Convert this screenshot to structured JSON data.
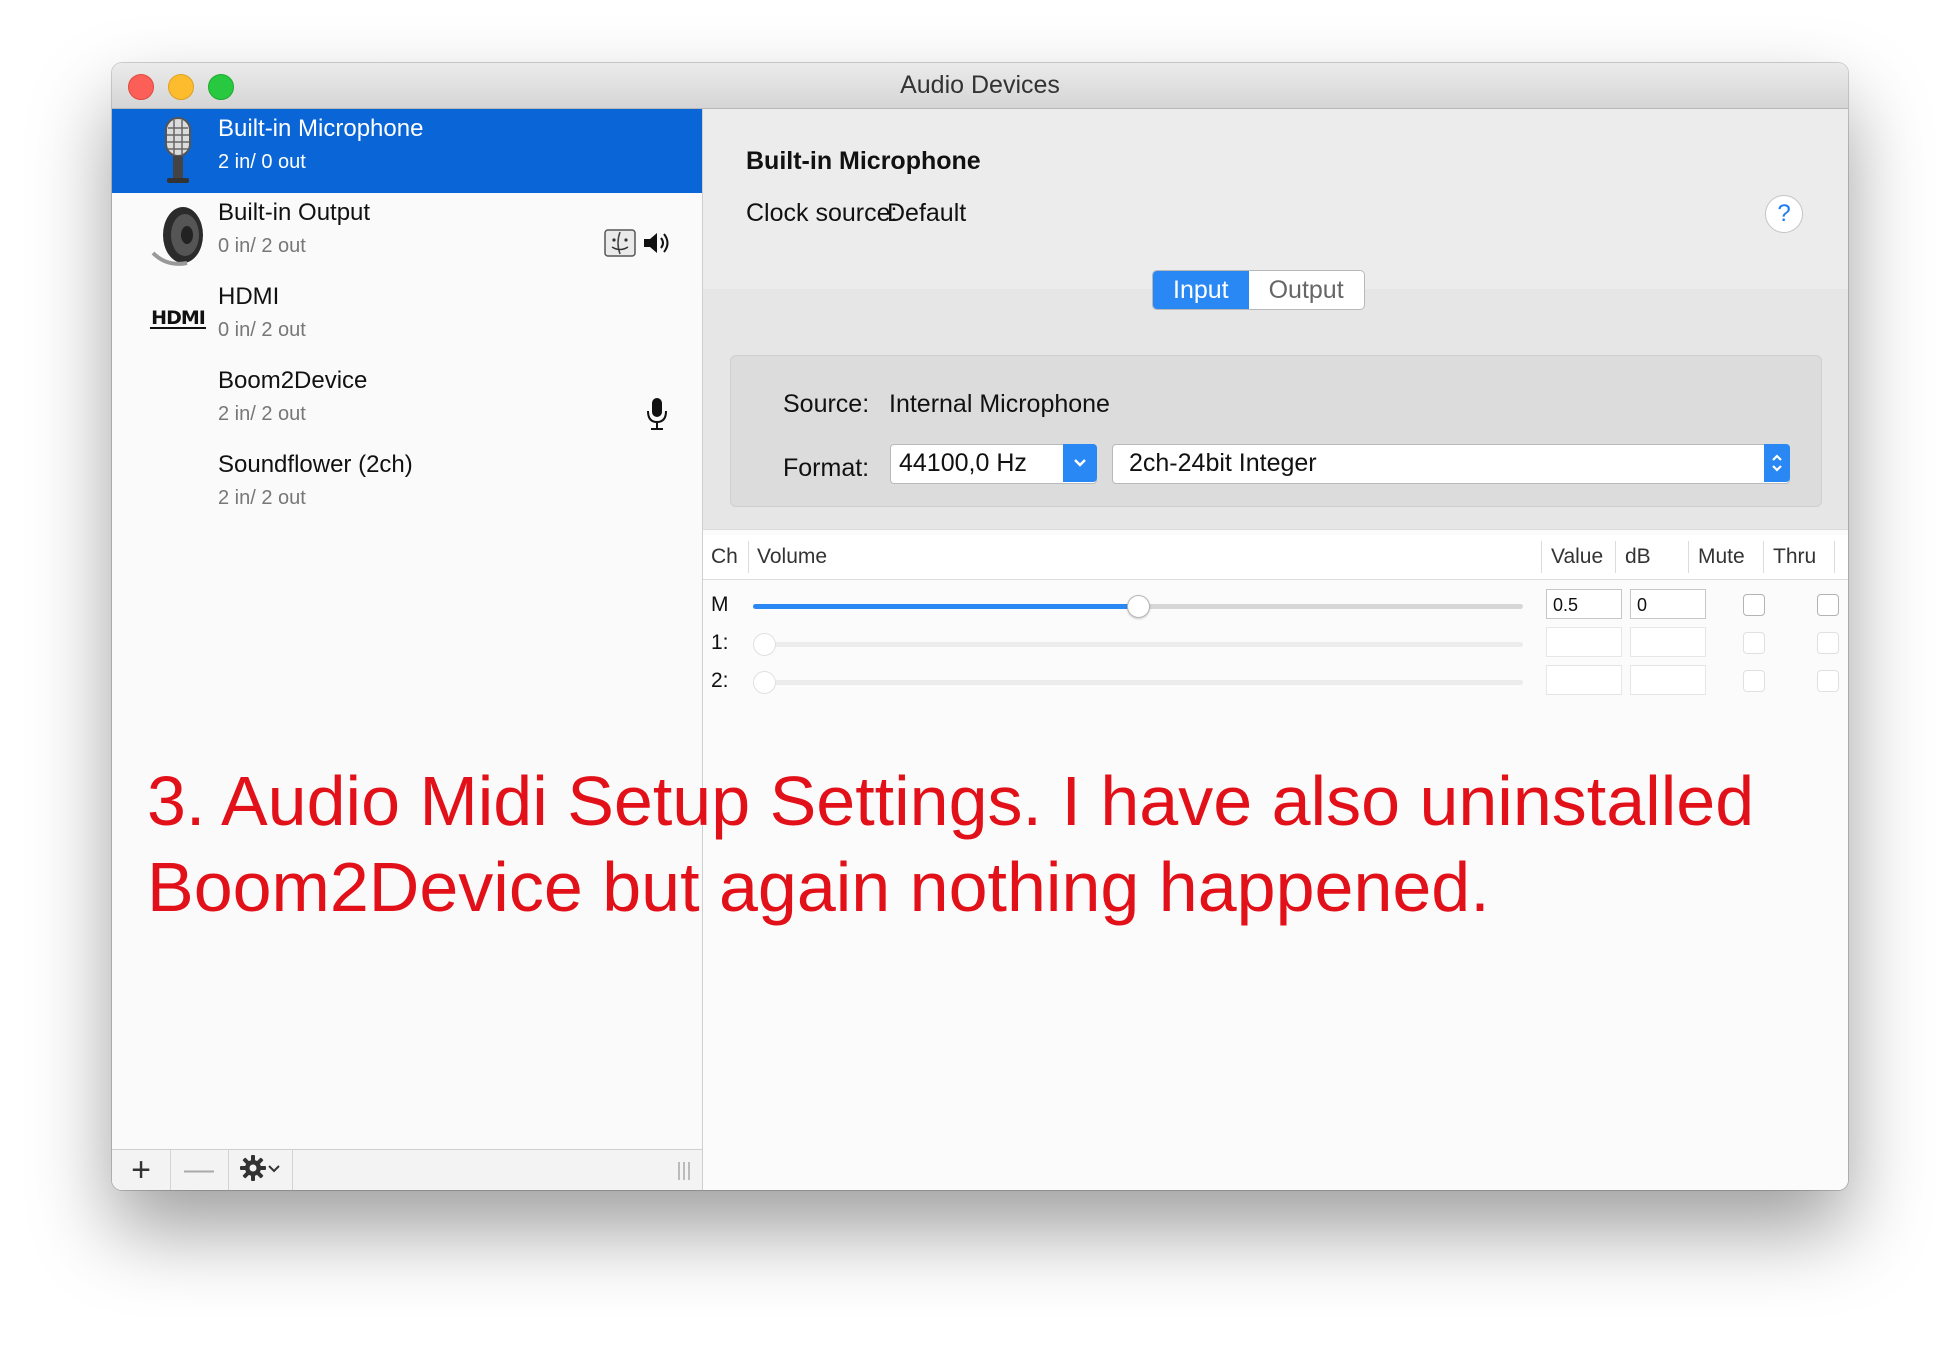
{
  "window": {
    "title": "Audio Devices"
  },
  "sidebar": {
    "devices": [
      {
        "name": "Built-in Microphone",
        "io": "2 in/ 0 out",
        "icon": "microphone-icon",
        "selected": true
      },
      {
        "name": "Built-in Output",
        "io": "0 in/ 2 out",
        "icon": "speaker-icon",
        "status_icons": [
          "system-sound-icon",
          "default-output-speaker-icon"
        ]
      },
      {
        "name": "HDMI",
        "io": "0 in/ 2 out",
        "icon": "hdmi-logo-icon",
        "icon_text": "HDMI"
      },
      {
        "name": "Boom2Device",
        "io": "2 in/ 2 out",
        "status_icons": [
          "default-input-mic-icon"
        ]
      },
      {
        "name": "Soundflower (2ch)",
        "io": "2 in/ 2 out"
      }
    ],
    "toolbar": {
      "add": "+",
      "remove": "—"
    }
  },
  "detail": {
    "device_title": "Built-in Microphone",
    "clock_label": "Clock source:",
    "clock_value": "Default",
    "help": "?",
    "tabs": [
      {
        "label": "Input",
        "active": true
      },
      {
        "label": "Output",
        "active": false
      }
    ],
    "source_label": "Source:",
    "source_value": "Internal Microphone",
    "format_label": "Format:",
    "sample_rate": "44100,0 Hz",
    "bit_format": "2ch-24bit Integer",
    "columns": {
      "ch": "Ch",
      "volume": "Volume",
      "value": "Value",
      "db": "dB",
      "mute": "Mute",
      "thru": "Thru"
    },
    "channels": [
      {
        "ch": "M",
        "volume": 0.5,
        "value": "0.5",
        "db": "0",
        "enabled": true
      },
      {
        "ch": "1:",
        "volume": 0,
        "value": "",
        "db": "",
        "enabled": false
      },
      {
        "ch": "2:",
        "volume": 0,
        "value": "",
        "db": "",
        "enabled": false
      }
    ]
  },
  "annotation": {
    "line1": "3. Audio Midi Setup Settings. I have also uninstalled",
    "line2": "Boom2Device but again nothing happened.",
    "color": "#e21018"
  },
  "colors": {
    "selection": "#0a66d7",
    "accent": "#2a88f5"
  }
}
